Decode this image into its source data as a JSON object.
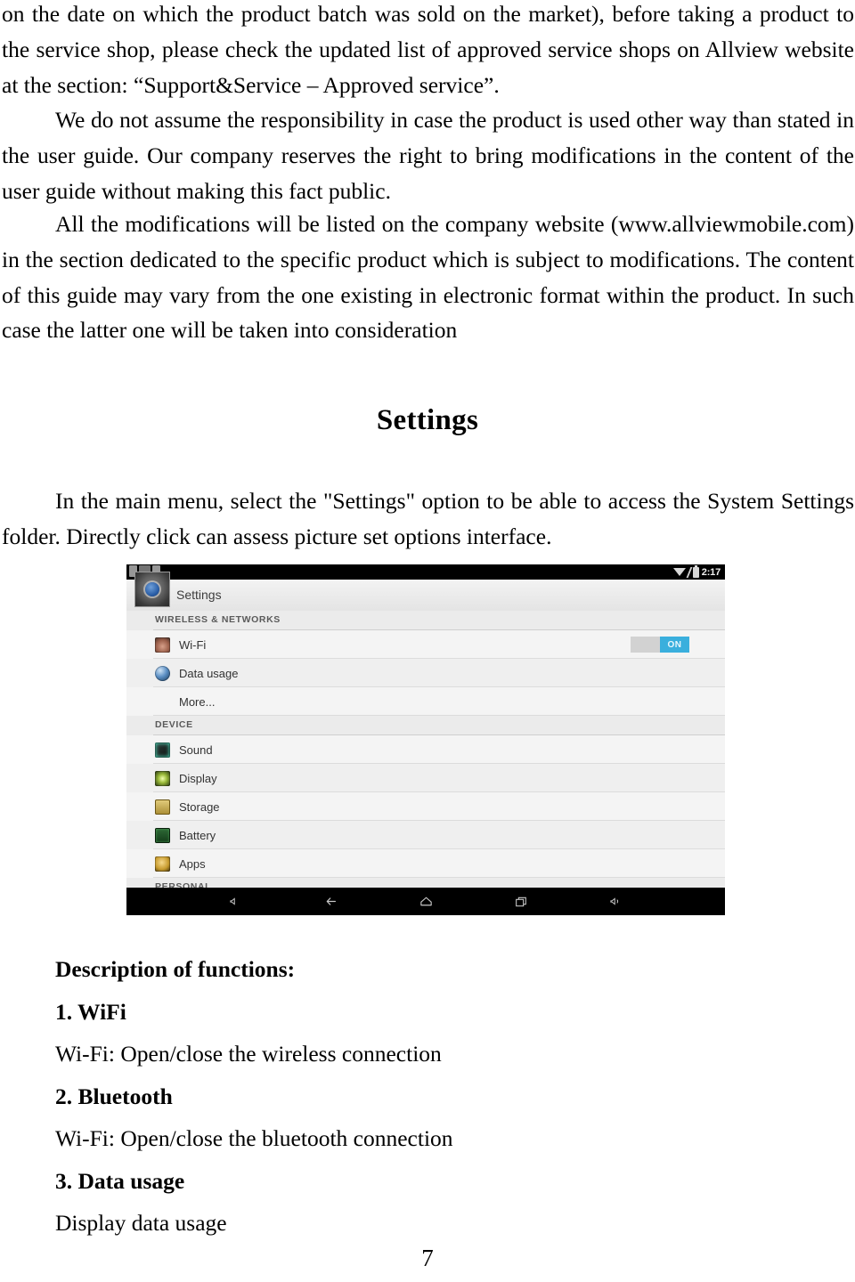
{
  "document": {
    "paragraph_warranty": "on the date on which the product batch was sold on the market), before taking a product to the service shop, please check the updated list of approved service shops on Allview website at the section: “Support&Service – Approved service”.",
    "paragraph_responsibility": "We do not assume the responsibility in case the product is used other way than stated in the user guide. Our company reserves the right to bring modifications in the content of the user guide without making this fact public.",
    "paragraph_modifications": "All the modifications will be listed on the company website (www.allviewmobile.com) in the section dedicated to the specific product which is subject to modifications. The content of this guide may vary from the one existing in electronic format within the product. In such case the latter one will be taken into consideration",
    "heading_settings": "Settings",
    "paragraph_settings_intro": "In the main menu, select the \"Settings\" option to be able to access the System Settings folder. Directly click can assess picture set options interface.",
    "page_number": "7"
  },
  "descriptions": {
    "title": "Description of functions:",
    "items": [
      {
        "heading": "1. WiFi",
        "body": "Wi-Fi: Open/close the wireless connection"
      },
      {
        "heading": "2. Bluetooth",
        "body": "Wi-Fi: Open/close the bluetooth connection"
      },
      {
        "heading": "3. Data usage",
        "body": "Display data usage"
      }
    ]
  },
  "screenshot": {
    "status_bar": {
      "time": "2:17",
      "icons": [
        "wifi-icon",
        "signal-slash-icon",
        "battery-icon"
      ]
    },
    "action_bar": {
      "icon": "settings-gear-icon",
      "title": "Settings"
    },
    "sections": [
      {
        "header": "WIRELESS & NETWORKS",
        "rows": [
          {
            "icon": "wifi-row-icon",
            "label": "Wi-Fi",
            "toggle": "ON"
          },
          {
            "icon": "data-usage-icon",
            "label": "Data usage"
          },
          {
            "icon": "",
            "label": "More..."
          }
        ]
      },
      {
        "header": "DEVICE",
        "rows": [
          {
            "icon": "sound-icon",
            "label": "Sound"
          },
          {
            "icon": "display-icon",
            "label": "Display"
          },
          {
            "icon": "storage-icon",
            "label": "Storage"
          },
          {
            "icon": "battery-row-icon",
            "label": "Battery"
          },
          {
            "icon": "apps-icon",
            "label": "Apps"
          }
        ]
      },
      {
        "header": "PERSONAL",
        "rows": []
      }
    ],
    "nav_bar": {
      "buttons": [
        "volume-down-icon",
        "back-icon",
        "home-icon",
        "recent-apps-icon",
        "volume-up-icon"
      ]
    },
    "colors": {
      "toggle_on": "#3aafdd",
      "status_bar": "#000000",
      "list_background": "#f1f1f1"
    }
  }
}
